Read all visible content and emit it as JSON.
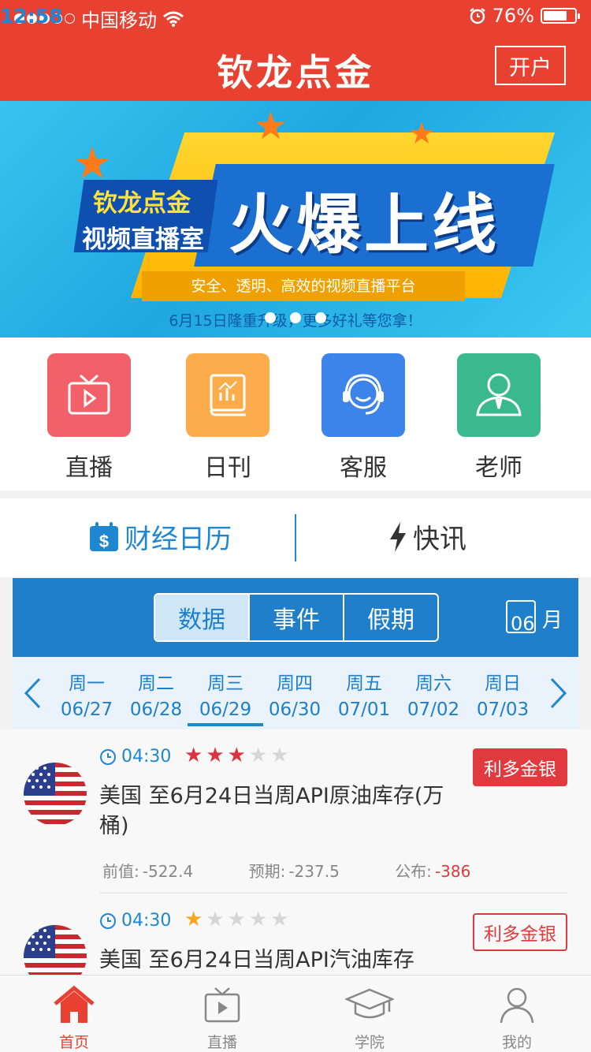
{
  "status_bar": {
    "carrier": "中国移动",
    "time": "12:58",
    "battery": "76%",
    "battery_level": 0.76
  },
  "header": {
    "title": "钦龙点金",
    "open_account": "开户"
  },
  "banner": {
    "brand": "钦龙点金",
    "subtitle": "视频直播室",
    "headline": "火爆上线",
    "slogan": "安全、透明、高效的视频直播平台",
    "note": "6月15日隆重升级，更多好礼等您拿！"
  },
  "quick_links": [
    {
      "label": "直播",
      "icon": "tv-icon",
      "color": "#f2616a"
    },
    {
      "label": "日刊",
      "icon": "book-chart-icon",
      "color": "#fdac4b"
    },
    {
      "label": "客服",
      "icon": "headset-icon",
      "color": "#3d84ea"
    },
    {
      "label": "老师",
      "icon": "teacher-icon",
      "color": "#3ab98f"
    }
  ],
  "section_tabs": {
    "calendar": "财经日历",
    "flash": "快讯"
  },
  "segments": {
    "data": "数据",
    "events": "事件",
    "holidays": "假期"
  },
  "month": {
    "number": "06",
    "unit": "月"
  },
  "week": [
    {
      "weekday": "周一",
      "date": "06/27"
    },
    {
      "weekday": "周二",
      "date": "06/28"
    },
    {
      "weekday": "周三",
      "date": "06/29"
    },
    {
      "weekday": "周四",
      "date": "06/30"
    },
    {
      "weekday": "周五",
      "date": "07/01"
    },
    {
      "weekday": "周六",
      "date": "07/02"
    },
    {
      "weekday": "周日",
      "date": "07/03"
    }
  ],
  "events": [
    {
      "time": "04:30",
      "importance": 3,
      "importance_max": 5,
      "badge": "利多金银",
      "title": "美国 至6月24日当周API原油库存(万桶)",
      "previous_label": "前值:",
      "previous": "-522.4",
      "forecast_label": "预期:",
      "forecast": "-237.5",
      "actual_label": "公布:",
      "actual": "-386"
    },
    {
      "time": "04:30",
      "importance": 1,
      "importance_max": 5,
      "badge": "利多金银",
      "title": "美国 至6月24日当周API汽油库存"
    }
  ],
  "tabbar": {
    "home": "首页",
    "live": "直播",
    "academy": "学院",
    "mine": "我的"
  },
  "colors": {
    "primary_red": "#e84132",
    "blue": "#1f7fcb",
    "badge_red": "#e03a3e",
    "star_red": "#d9343f",
    "star_gold": "#f5a623"
  }
}
